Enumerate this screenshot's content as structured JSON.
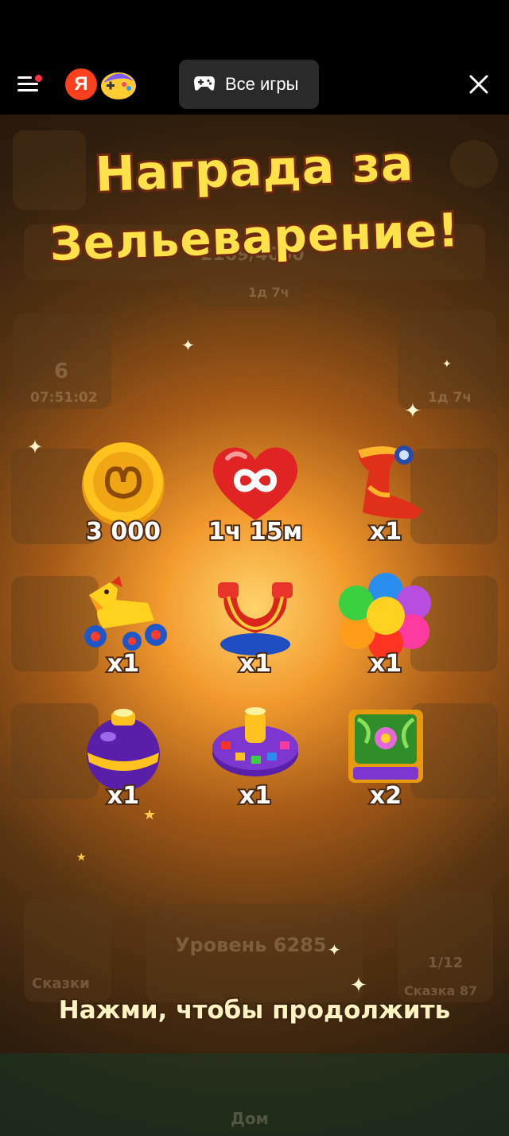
{
  "browser": {
    "all_games_label": "Все игры",
    "ya_letter": "Я"
  },
  "game": {
    "title_line1": "Награда за",
    "title_line2": "Зельеварение!",
    "continue_text": "Нажми, чтобы продолжить",
    "background_text": {
      "progress": "2169/4000",
      "timer_top": "1д 7ч",
      "level_badge": "6",
      "timer_left": "07:51:02",
      "timer_right": "1д 7ч",
      "level_button": "Уровень 6285",
      "story_progress": "1/12",
      "story_left": "Сказки",
      "story_right": "Сказка 87",
      "home": "Дом"
    },
    "rewards": [
      {
        "item": "coin-icon",
        "qty": "3 000"
      },
      {
        "item": "infinite-heart-icon",
        "qty": "1ч 15м"
      },
      {
        "item": "boot-icon",
        "qty": "x1"
      },
      {
        "item": "rocking-horse-icon",
        "qty": "x1"
      },
      {
        "item": "slingshot-icon",
        "qty": "x1"
      },
      {
        "item": "rainbow-flower-icon",
        "qty": "x1"
      },
      {
        "item": "purple-bomb-icon",
        "qty": "x1"
      },
      {
        "item": "spinning-top-icon",
        "qty": "x1"
      },
      {
        "item": "flower-box-icon",
        "qty": "x2"
      }
    ]
  }
}
